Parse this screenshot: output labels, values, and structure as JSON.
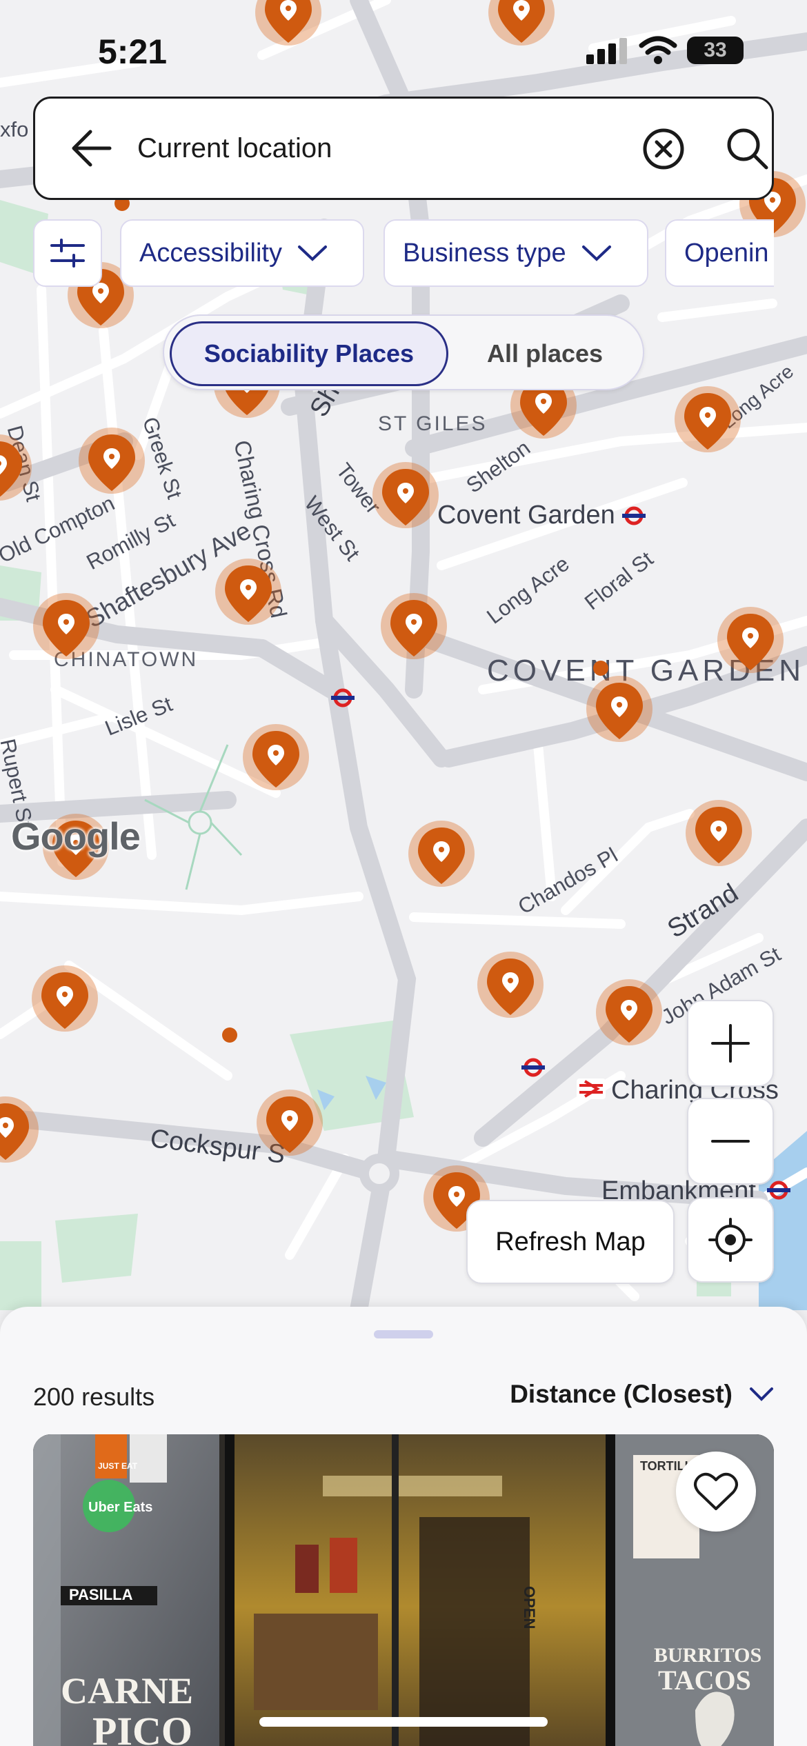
{
  "status_bar": {
    "time": "5:21",
    "battery": "33"
  },
  "search": {
    "value": "Current location"
  },
  "filters": [
    {
      "label": "Accessibility"
    },
    {
      "label": "Business type"
    },
    {
      "label": "Openin"
    }
  ],
  "toggle": {
    "active": "Sociability Places",
    "inactive": "All places"
  },
  "map": {
    "labels": {
      "st_giles": "ST GILES",
      "covent_garden_station": "Covent Garden",
      "covent_garden_area": "COVENT GARDEN",
      "chinatown": "CHINATOWN",
      "charing_cross_rd": "Charing Cross Rd",
      "shaftesbury_ave": "Shaftesbury Ave",
      "long_acre": "Long Acre",
      "long_acre_2": "Long Acre",
      "floral_st": "Floral St",
      "lisle_st": "Lisle St",
      "romilly_st": "Romilly St",
      "greek_st": "Greek St",
      "dean_st": "Dean St",
      "old_compton": "Old Compton",
      "rupert_st": "Rupert St",
      "west_st": "West St",
      "tower": "Tower",
      "shelton": "Shelton",
      "chandos_pl": "Chandos Pl",
      "strand": "Strand",
      "john_adam_st": "John Adam St",
      "charing_cross": "Charing Cross",
      "embankment": "Embankment",
      "cockspur": "Cockspur S",
      "sha": "Sha",
      "oxfo": "xfo",
      "google": "Google"
    }
  },
  "controls": {
    "refresh": "Refresh Map"
  },
  "results": {
    "count": "200 results",
    "sort": "Distance (Closest)"
  },
  "card": {
    "sign_just_eat": "JUST EAT",
    "sign_uber": "Uber Eats",
    "sign_pasilla": "PASILLA",
    "sign_carne": "CARNE",
    "sign_pico": "PICO",
    "sign_tortilla": "TORTILLA",
    "sign_burritos": "BURRITOS",
    "sign_tacos": "TACOS",
    "sign_open": "OPEN"
  },
  "colors": {
    "pin": "#cf5a10",
    "accent": "#1e2a86",
    "chip_border": "#dcd9ee"
  }
}
